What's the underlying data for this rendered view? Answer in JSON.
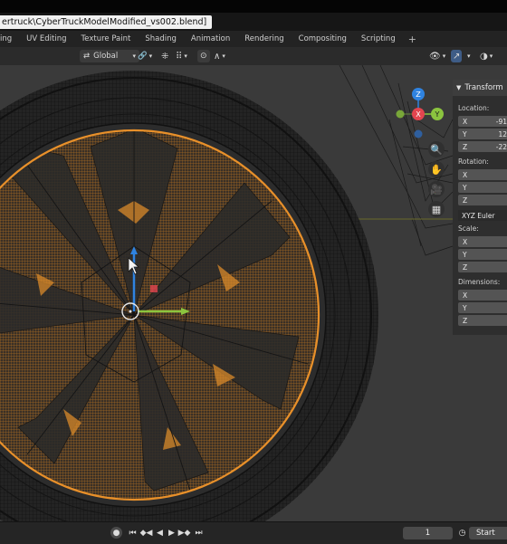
{
  "window": {
    "title": "ertruck\\CyberTruckModelModified_vs002.blend]"
  },
  "workspace_tabs": [
    "ing",
    "UV Editing",
    "Texture Paint",
    "Shading",
    "Animation",
    "Rendering",
    "Compositing",
    "Scripting"
  ],
  "workspace_add_label": "+",
  "header": {
    "orientation_label": "Global"
  },
  "gizmo": {
    "axis_x": "X",
    "axis_y": "Y",
    "axis_z": "Z"
  },
  "n_panel": {
    "tab_label": "Transform",
    "location_label": "Location:",
    "location": [
      {
        "axis": "X",
        "value": "-91"
      },
      {
        "axis": "Y",
        "value": "12"
      },
      {
        "axis": "Z",
        "value": "-22"
      }
    ],
    "rotation_label": "Rotation:",
    "rotation_axes": [
      "X",
      "Y",
      "Z"
    ],
    "rotation_mode": "XYZ Euler",
    "scale_label": "Scale:",
    "scale_axes": [
      "X",
      "Y",
      "Z"
    ],
    "dimensions_label": "Dimensions:",
    "dimensions_axes": [
      "X",
      "Y",
      "Z"
    ]
  },
  "timeline": {
    "current_frame": "1",
    "start_label": "Start"
  },
  "colors": {
    "selection_orange": "#e8902a",
    "viewport_bg": "#3a3a3a",
    "axis_x": "#e2454f",
    "axis_y": "#8bc43f",
    "axis_z": "#2f83e0"
  }
}
